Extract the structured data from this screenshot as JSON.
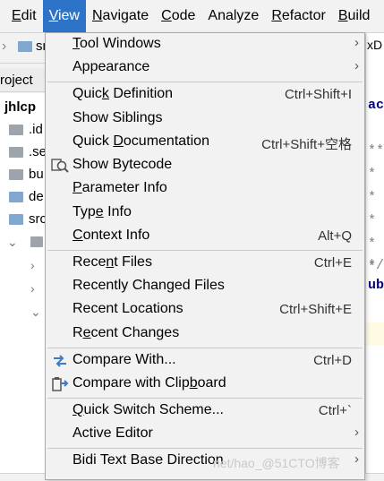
{
  "menubar": {
    "items": [
      {
        "label": "Edit",
        "mnemonic": "E",
        "rest": "dit"
      },
      {
        "label": "View",
        "mnemonic": "V",
        "rest": "iew",
        "active": true
      },
      {
        "label": "Navigate",
        "mnemonic": "N",
        "rest": "avigate"
      },
      {
        "label": "Code",
        "mnemonic": "C",
        "rest": "ode"
      },
      {
        "label": "Analyze",
        "mnemonic": "",
        "rest": "Analyze"
      },
      {
        "label": "Refactor",
        "mnemonic": "R",
        "rest": "efactor"
      },
      {
        "label": "Build",
        "mnemonic": "B",
        "rest": "uild"
      }
    ]
  },
  "background": {
    "breadcrumb": "sr",
    "project_tab": "roject",
    "tree": [
      {
        "name": "jhlcp",
        "type": "root"
      },
      {
        "name": ".id",
        "type": "folder-gray"
      },
      {
        "name": ".se",
        "type": "folder-gray"
      },
      {
        "name": "bu",
        "type": "folder-gray"
      },
      {
        "name": "de",
        "type": "folder-blue"
      },
      {
        "name": "src",
        "type": "folder-blue"
      }
    ],
    "editor_tab": "xD",
    "editor_lines": [
      "ac",
      "**",
      "* ",
      "* ",
      "* ",
      "* ",
      "* ",
      "*/",
      "ub"
    ]
  },
  "menu": {
    "items": [
      {
        "pre": "",
        "mn": "T",
        "post": "ool Windows",
        "shortcut": "",
        "submenu": true,
        "icon": ""
      },
      {
        "pre": "Appearance",
        "mn": "",
        "post": "",
        "shortcut": "",
        "submenu": true,
        "icon": ""
      },
      {
        "pre": "Quic",
        "mn": "k",
        "post": " Definition",
        "shortcut": "Ctrl+Shift+I",
        "submenu": false,
        "icon": ""
      },
      {
        "pre": "Show Siblings",
        "mn": "",
        "post": "",
        "shortcut": "",
        "submenu": false,
        "icon": ""
      },
      {
        "pre": "Quick ",
        "mn": "D",
        "post": "ocumentation",
        "shortcut": "Ctrl+Shift+空格",
        "submenu": false,
        "icon": ""
      },
      {
        "pre": "Show Bytecode",
        "mn": "",
        "post": "",
        "shortcut": "",
        "submenu": false,
        "icon": "bytecode-icon"
      },
      {
        "pre": "",
        "mn": "P",
        "post": "arameter Info",
        "shortcut": "",
        "submenu": false,
        "icon": ""
      },
      {
        "pre": "Typ",
        "mn": "e",
        "post": " Info",
        "shortcut": "",
        "submenu": false,
        "icon": ""
      },
      {
        "pre": "",
        "mn": "C",
        "post": "ontext Info",
        "shortcut": "Alt+Q",
        "submenu": false,
        "icon": ""
      },
      {
        "pre": "Rece",
        "mn": "n",
        "post": "t Files",
        "shortcut": "Ctrl+E",
        "submenu": false,
        "icon": ""
      },
      {
        "pre": "Recently Changed Files",
        "mn": "",
        "post": "",
        "shortcut": "",
        "submenu": false,
        "icon": ""
      },
      {
        "pre": "Recent Locations",
        "mn": "",
        "post": "",
        "shortcut": "Ctrl+Shift+E",
        "submenu": false,
        "icon": ""
      },
      {
        "pre": "R",
        "mn": "e",
        "post": "cent Changes",
        "shortcut": "",
        "submenu": false,
        "icon": ""
      },
      {
        "pre": "Compare With...",
        "mn": "",
        "post": "",
        "shortcut": "Ctrl+D",
        "submenu": false,
        "icon": "compare-arrows-icon"
      },
      {
        "pre": "Compare with Clip",
        "mn": "b",
        "post": "oard",
        "shortcut": "",
        "submenu": false,
        "icon": "clipboard-compare-icon"
      },
      {
        "pre": "",
        "mn": "Q",
        "post": "uick Switch Scheme...",
        "shortcut": "Ctrl+`",
        "submenu": false,
        "icon": ""
      },
      {
        "pre": "Active Editor",
        "mn": "",
        "post": "",
        "shortcut": "",
        "submenu": true,
        "icon": ""
      },
      {
        "pre": "Bidi Text Base Direction",
        "mn": "",
        "post": "",
        "shortcut": "",
        "submenu": true,
        "icon": ""
      }
    ]
  },
  "watermark": "net/hao_@51CTO博客",
  "colors": {
    "menu_active": "#2d74c9",
    "menu_bg": "#f2f2f2",
    "icon_blue": "#3c7cc4"
  }
}
